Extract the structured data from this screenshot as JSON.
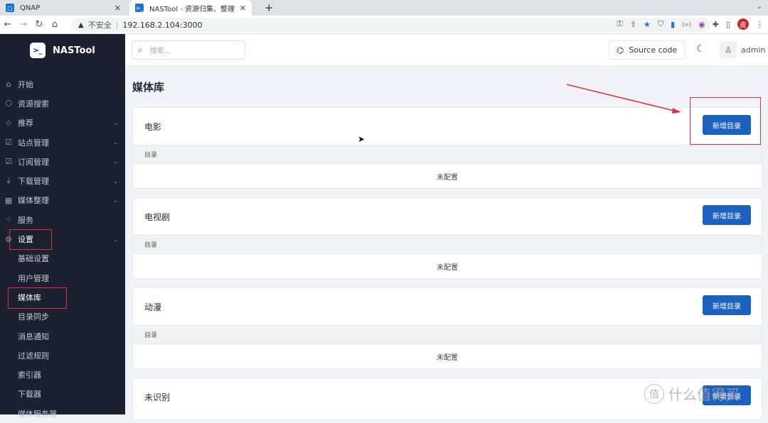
{
  "browser": {
    "tabs": [
      {
        "label": "QNAP",
        "icon": "qnap-icon"
      },
      {
        "label": "NASTool - 资源归集、整理自动化",
        "icon": "nastool-icon",
        "active": true
      }
    ],
    "address": {
      "security": "不安全",
      "url": "192.168.2.104:3000"
    },
    "profile_initial": "皮"
  },
  "sidebar": {
    "brand": "NASTool",
    "items": [
      {
        "label": "开始",
        "icon": "home-icon"
      },
      {
        "label": "资源搜索",
        "icon": "cube-icon"
      },
      {
        "label": "推荐",
        "icon": "star-icon",
        "expandable": true
      },
      {
        "label": "站点管理",
        "icon": "checkbox-icon",
        "expandable": true
      },
      {
        "label": "订阅管理",
        "icon": "checkbox-icon",
        "expandable": true
      },
      {
        "label": "下载管理",
        "icon": "download-icon",
        "expandable": true
      },
      {
        "label": "媒体整理",
        "icon": "film-icon",
        "expandable": true
      },
      {
        "label": "服务",
        "icon": "grid-icon"
      },
      {
        "label": "设置",
        "icon": "gear-icon",
        "expandable": true,
        "expanded": true
      }
    ],
    "sub_items": [
      "基础设置",
      "用户管理",
      "媒体库",
      "目录同步",
      "消息通知",
      "过滤规则",
      "索引器",
      "下载器",
      "媒体服务器"
    ],
    "active_sub": "媒体库"
  },
  "topbar": {
    "search_placeholder": "搜索...",
    "source_code": "Source code",
    "user": "admin"
  },
  "page": {
    "title": "媒体库",
    "sections": [
      {
        "title": "电影",
        "button": "新增目录",
        "column": "目录",
        "empty": "未配置"
      },
      {
        "title": "电视剧",
        "button": "新增目录",
        "column": "目录",
        "empty": "未配置"
      },
      {
        "title": "动漫",
        "button": "新增目录",
        "column": "目录",
        "empty": "未配置"
      },
      {
        "title": "未识别",
        "button": "新增目录"
      }
    ]
  },
  "watermark": {
    "circle": "值",
    "text": "什么值得买"
  },
  "colors": {
    "sidebar_bg": "#1b2130",
    "primary": "#1d61bf",
    "annotation": "#e0303a"
  }
}
